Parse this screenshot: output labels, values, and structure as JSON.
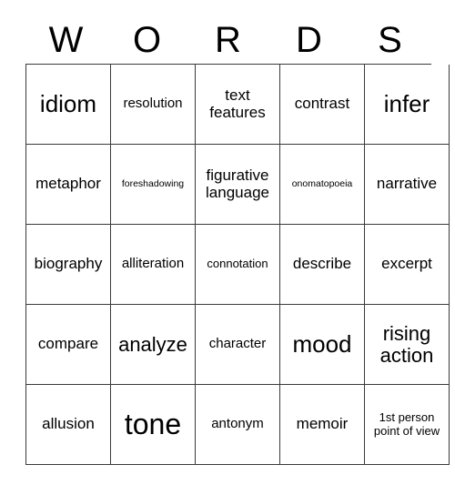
{
  "card": {
    "header": {
      "letters": [
        "W",
        "O",
        "R",
        "D",
        "S"
      ]
    },
    "rows": [
      [
        {
          "text": "idiom",
          "size": "xxl"
        },
        {
          "text": "resolution",
          "size": "m"
        },
        {
          "text": "text features",
          "size": "l"
        },
        {
          "text": "contrast",
          "size": "l"
        },
        {
          "text": "infer",
          "size": "xxl"
        }
      ],
      [
        {
          "text": "metaphor",
          "size": "l"
        },
        {
          "text": "foreshadowing",
          "size": "xs"
        },
        {
          "text": "figurative language",
          "size": "l"
        },
        {
          "text": "onomatopoeia",
          "size": "xs"
        },
        {
          "text": "narrative",
          "size": "l"
        }
      ],
      [
        {
          "text": "biography",
          "size": "l"
        },
        {
          "text": "alliteration",
          "size": "m"
        },
        {
          "text": "connotation",
          "size": "s"
        },
        {
          "text": "describe",
          "size": "l"
        },
        {
          "text": "excerpt",
          "size": "l"
        }
      ],
      [
        {
          "text": "compare",
          "size": "l"
        },
        {
          "text": "analyze",
          "size": "xl"
        },
        {
          "text": "character",
          "size": "m"
        },
        {
          "text": "mood",
          "size": "xxl"
        },
        {
          "text": "rising action",
          "size": "xl"
        }
      ],
      [
        {
          "text": "allusion",
          "size": "l"
        },
        {
          "text": "tone",
          "size": "huge"
        },
        {
          "text": "antonym",
          "size": "m"
        },
        {
          "text": "memoir",
          "size": "l"
        },
        {
          "text": "1st person point of view",
          "size": "s"
        }
      ]
    ],
    "colors": {
      "grid_line": "#3a3a3a",
      "text": "#000000",
      "background": "#ffffff"
    }
  }
}
